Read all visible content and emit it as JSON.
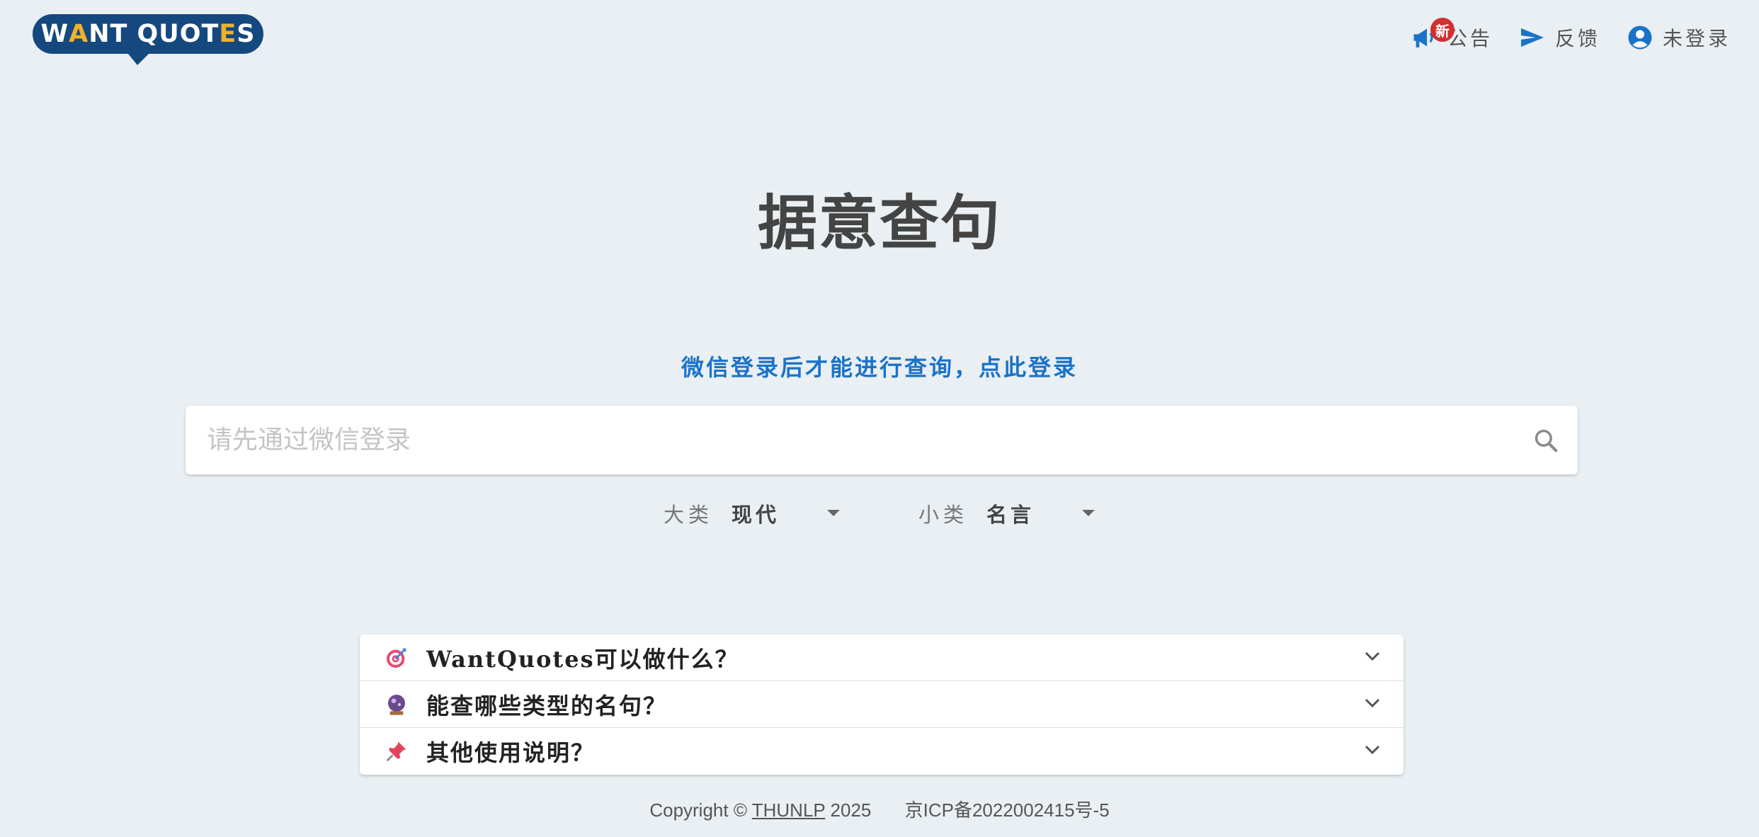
{
  "logo": {
    "text_a": "W",
    "text_accent1": "A",
    "text_b": "NT QUOT",
    "text_accent2": "E",
    "text_c": "S"
  },
  "nav": {
    "announce_badge": "新",
    "announce_label": "公告",
    "feedback_label": "反馈",
    "login_label": "未登录"
  },
  "hero": {
    "title": "据意查句",
    "login_hint": "微信登录后才能进行查询，点此登录"
  },
  "search": {
    "placeholder": "请先通过微信登录",
    "value": ""
  },
  "selects": {
    "major_caption": "大类",
    "major_value": "现代",
    "minor_caption": "小类",
    "minor_value": "名言"
  },
  "faq": [
    {
      "icon": "target-icon",
      "question": "WantQuotes可以做什么？"
    },
    {
      "icon": "crystal-ball-icon",
      "question": "能查哪些类型的名句？"
    },
    {
      "icon": "pushpin-icon",
      "question": "其他使用说明？"
    }
  ],
  "footer": {
    "copyright_prefix": "Copyright © ",
    "org_link": "THUNLP",
    "year": " 2025",
    "icp": "京ICP备2022002415号-5"
  },
  "colors": {
    "background": "#e9eff2",
    "brand_blue": "#15487f",
    "brand_yellow": "#f0b22b",
    "link_blue": "#1a73c8",
    "badge_red": "#d32f2f"
  }
}
